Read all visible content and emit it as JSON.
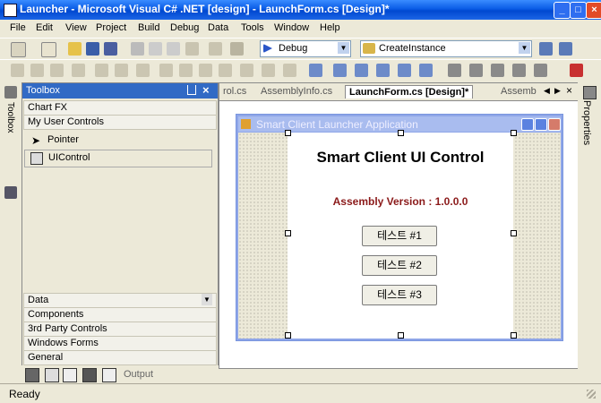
{
  "window": {
    "title": "Launcher - Microsoft Visual C# .NET [design] - LaunchForm.cs [Design]*",
    "buttons": [
      "_",
      "□",
      "×"
    ]
  },
  "menu": [
    "File",
    "Edit",
    "View",
    "Project",
    "Build",
    "Debug",
    "Data",
    "Tools",
    "Window",
    "Help"
  ],
  "toolbar": {
    "config_value": "Debug",
    "find_value": "CreateInstance"
  },
  "sidebar_left": {
    "toolbox_tab": "Toolbox"
  },
  "toolbox": {
    "title": "Toolbox",
    "categories_top": [
      "Chart FX",
      "My User Controls"
    ],
    "items": [
      "Pointer",
      "UIControl"
    ],
    "categories_bottom": [
      "Data",
      "Components",
      "3rd Party Controls",
      "Windows Forms",
      "General"
    ],
    "scroll_indicator": "▼",
    "output_label": "Output"
  },
  "tabs": {
    "items": [
      "rol.cs",
      "AssemblyInfo.cs",
      "LaunchForm.cs [Design]*",
      "Assemb"
    ],
    "active": "LaunchForm.cs [Design]*"
  },
  "form": {
    "title": "Smart Client Launcher Application",
    "control_title": "Smart Client UI Control",
    "version_text": "Assembly Version : 1.0.0.0",
    "buttons": [
      "테스트 #1",
      "테스트 #2",
      "테스트 #3"
    ]
  },
  "properties": {
    "label": "Properties"
  },
  "status": {
    "text": "Ready"
  },
  "colors": {
    "accent": "#316ac5",
    "version_text": "#8b1a1a"
  }
}
